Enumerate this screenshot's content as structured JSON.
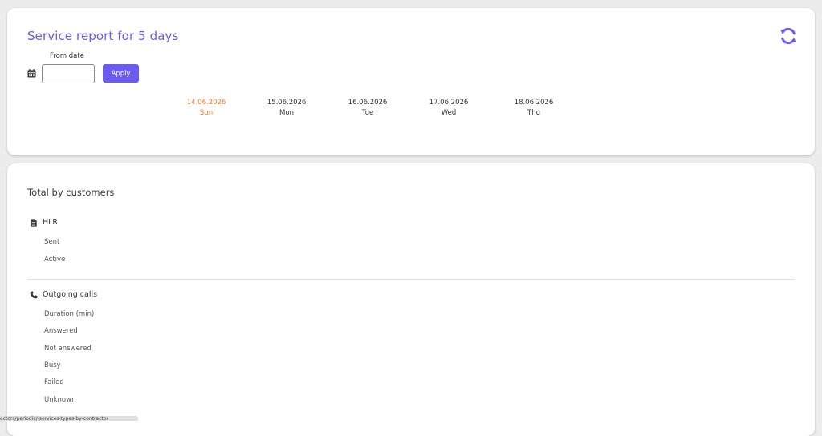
{
  "header": {
    "title": "Service report for 5 days",
    "refresh_icon": "refresh-icon"
  },
  "filter": {
    "from_label": "From date",
    "date_value": "",
    "date_placeholder": "",
    "apply_label": "Apply",
    "calendar_icon": "calendar-icon"
  },
  "days": [
    {
      "date": "14.06.2026",
      "weekday": "Sun"
    },
    {
      "date": "15.06.2026",
      "weekday": "Mon"
    },
    {
      "date": "16.06.2026",
      "weekday": "Tue"
    },
    {
      "date": "17.06.2026",
      "weekday": "Wed"
    },
    {
      "date": "18.06.2026",
      "weekday": "Thu"
    }
  ],
  "colors": {
    "accent": "#6a5cf0",
    "today": "#ee7d2b"
  },
  "totals": {
    "title": "Total by customers",
    "groups": [
      {
        "name": "HLR",
        "icon": "document-icon",
        "rows": [
          "Sent",
          "Active"
        ]
      },
      {
        "name": "Outgoing calls",
        "icon": "phone-icon",
        "rows": [
          "Duration (min)",
          "Answered",
          "Not answered",
          "Busy",
          "Failed",
          "Unknown"
        ]
      }
    ]
  },
  "status_bar": {
    "text": "ectors/periodic/-services-types-by-contractor"
  }
}
